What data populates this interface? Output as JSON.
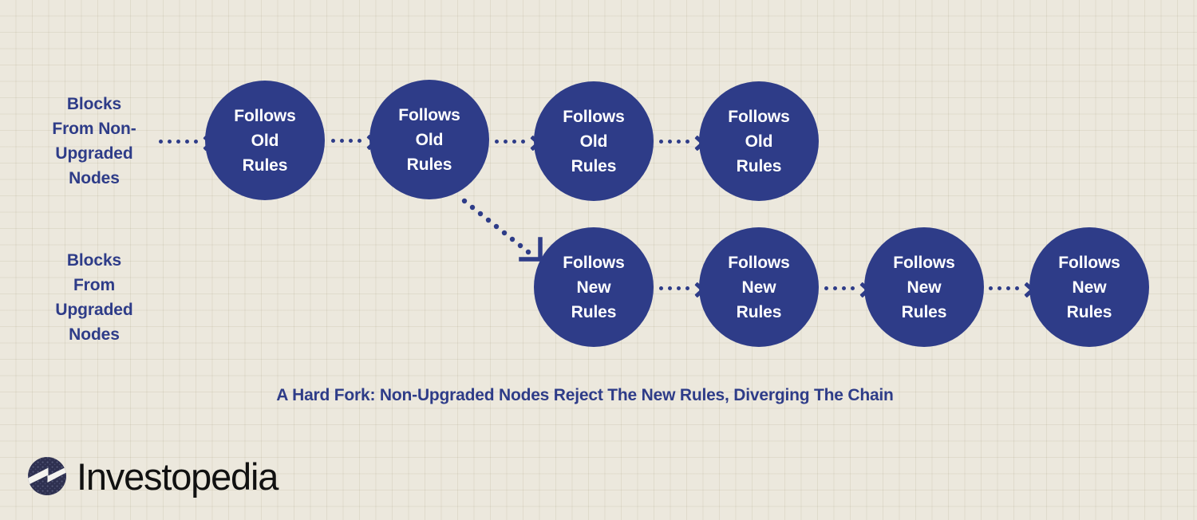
{
  "diagram": {
    "caption": "A Hard Fork: Non-Upgraded Nodes Reject The New Rules, Diverging The Chain",
    "colors": {
      "background": "#ece8dd",
      "grid_line": "#e2ddd0",
      "node_fill": "#2e3c88",
      "node_text": "#ffffff",
      "accent_text": "#2e3c88",
      "logo_text": "#111111",
      "logo_mark": "#2e3050"
    },
    "rows": [
      {
        "id": "non-upgraded",
        "label": "Blocks From Non- Upgraded Nodes",
        "label_lines": [
          "Blocks",
          "From Non-",
          "Upgraded",
          "Nodes"
        ],
        "node_label": "Follows Old Rules",
        "node_lines": [
          "Follows",
          "Old",
          "Rules"
        ],
        "node_count": 4
      },
      {
        "id": "upgraded",
        "label": "Blocks From Upgraded Nodes",
        "label_lines": [
          "Blocks",
          "From",
          "Upgraded",
          "Nodes"
        ],
        "node_label": "Follows New Rules",
        "node_lines": [
          "Follows",
          "New",
          "Rules"
        ],
        "node_count": 4
      }
    ],
    "arrows": {
      "entry": "dotted-arrow-right",
      "chain": "dotted-arrow-right",
      "fork": "dotted-arrow-diagonal-down-right"
    }
  },
  "logo": {
    "brand": "Investopedia",
    "mark": "investopedia-z-icon"
  }
}
